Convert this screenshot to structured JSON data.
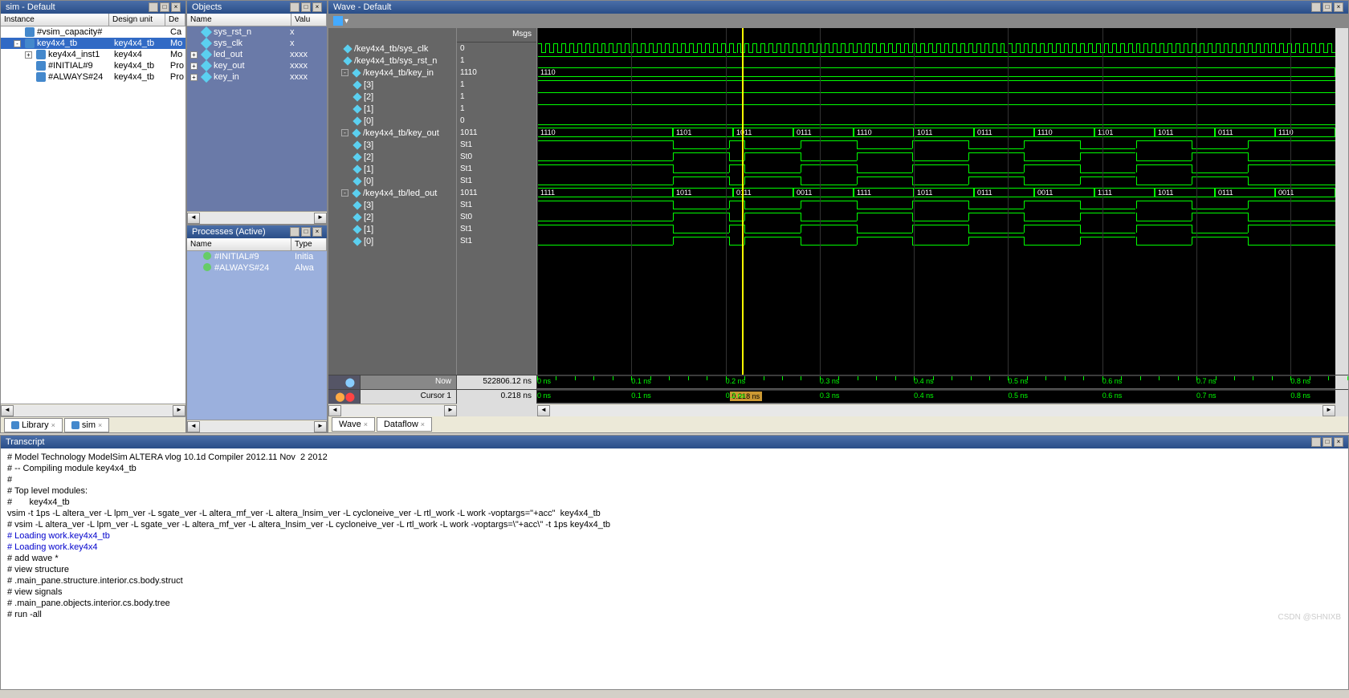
{
  "sim": {
    "title": "sim - Default",
    "columns": [
      "Instance",
      "Design unit",
      "De"
    ],
    "rows": [
      {
        "name": "#vsim_capacity#",
        "du": "",
        "ty": "Ca",
        "indent": 1,
        "exp": null
      },
      {
        "name": "key4x4_tb",
        "du": "key4x4_tb",
        "ty": "Mo",
        "indent": 1,
        "exp": "-",
        "sel": true
      },
      {
        "name": "key4x4_inst1",
        "du": "key4x4",
        "ty": "Mo",
        "indent": 2,
        "exp": "+"
      },
      {
        "name": "#INITIAL#9",
        "du": "key4x4_tb",
        "ty": "Pro",
        "indent": 2,
        "exp": null
      },
      {
        "name": "#ALWAYS#24",
        "du": "key4x4_tb",
        "ty": "Pro",
        "indent": 2,
        "exp": null
      }
    ],
    "tabs": [
      "Library",
      "sim"
    ]
  },
  "objects": {
    "title": "Objects",
    "columns": [
      "Name",
      "Valu"
    ],
    "rows": [
      {
        "name": "sys_rst_n",
        "val": "x",
        "exp": null
      },
      {
        "name": "sys_clk",
        "val": "x",
        "exp": null
      },
      {
        "name": "led_out",
        "val": "xxxx",
        "exp": "+"
      },
      {
        "name": "key_out",
        "val": "xxxx",
        "exp": "+"
      },
      {
        "name": "key_in",
        "val": "xxxx",
        "exp": "+"
      }
    ]
  },
  "processes": {
    "title": "Processes (Active)",
    "columns": [
      "Name",
      "Type"
    ],
    "rows": [
      {
        "name": "#INITIAL#9",
        "type": "Initia"
      },
      {
        "name": "#ALWAYS#24",
        "type": "Alwa"
      }
    ]
  },
  "wave": {
    "title": "Wave - Default",
    "msgs_header": "Msgs",
    "signals": [
      {
        "name": "/key4x4_tb/sys_clk",
        "msg": "0",
        "indent": 1,
        "type": "clock"
      },
      {
        "name": "/key4x4_tb/sys_rst_n",
        "msg": "1",
        "indent": 1,
        "type": "high"
      },
      {
        "name": "/key4x4_tb/key_in",
        "msg": "1110",
        "indent": 1,
        "exp": "-",
        "type": "bus",
        "values": [
          "1110"
        ]
      },
      {
        "name": "[3]",
        "msg": "1",
        "indent": 2,
        "type": "high"
      },
      {
        "name": "[2]",
        "msg": "1",
        "indent": 2,
        "type": "high"
      },
      {
        "name": "[1]",
        "msg": "1",
        "indent": 2,
        "type": "high"
      },
      {
        "name": "[0]",
        "msg": "0",
        "indent": 2,
        "type": "low"
      },
      {
        "name": "/key4x4_tb/key_out",
        "msg": "1011",
        "indent": 1,
        "exp": "-",
        "type": "bus",
        "values": [
          "1110",
          "1101",
          "1011",
          "0111",
          "1110",
          "1011",
          "0111",
          "1110",
          "1101",
          "1011",
          "0111",
          "1110"
        ]
      },
      {
        "name": "[3]",
        "msg": "St1",
        "indent": 2,
        "type": "var1"
      },
      {
        "name": "[2]",
        "msg": "St0",
        "indent": 2,
        "type": "var2"
      },
      {
        "name": "[1]",
        "msg": "St1",
        "indent": 2,
        "type": "var3"
      },
      {
        "name": "[0]",
        "msg": "St1",
        "indent": 2,
        "type": "var4"
      },
      {
        "name": "/key4x4_tb/led_out",
        "msg": "1011",
        "indent": 1,
        "exp": "-",
        "type": "bus",
        "values": [
          "1111",
          "1011",
          "0111",
          "0011",
          "1111",
          "1011",
          "0111",
          "0011",
          "1111",
          "1011",
          "0111",
          "0011"
        ]
      },
      {
        "name": "[3]",
        "msg": "St1",
        "indent": 2,
        "type": "var1"
      },
      {
        "name": "[2]",
        "msg": "St0",
        "indent": 2,
        "type": "var2"
      },
      {
        "name": "[1]",
        "msg": "St1",
        "indent": 2,
        "type": "var3"
      },
      {
        "name": "[0]",
        "msg": "St1",
        "indent": 2,
        "type": "var4"
      }
    ],
    "now_label": "Now",
    "now_value": "522806.12 ns",
    "cursor_label": "Cursor 1",
    "cursor_value": "0.218 ns",
    "cursor_badge": "0.218 ns",
    "time_ticks": [
      "0 ns",
      "0.1 ns",
      "0.2 ns",
      "0.3 ns",
      "0.4 ns",
      "0.5 ns",
      "0.6 ns",
      "0.7 ns",
      "0.8 ns"
    ],
    "tabs": [
      "Wave",
      "Dataflow"
    ]
  },
  "transcript": {
    "title": "Transcript",
    "lines": [
      {
        "t": "# Model Technology ModelSim ALTERA vlog 10.1d Compiler 2012.11 Nov  2 2012"
      },
      {
        "t": "# -- Compiling module key4x4_tb"
      },
      {
        "t": "# "
      },
      {
        "t": "# Top level modules:"
      },
      {
        "t": "#       key4x4_tb"
      },
      {
        "t": ""
      },
      {
        "t": "vsim -t 1ps -L altera_ver -L lpm_ver -L sgate_ver -L altera_mf_ver -L altera_lnsim_ver -L cycloneive_ver -L rtl_work -L work -voptargs=\"+acc\"  key4x4_tb"
      },
      {
        "t": "# vsim -L altera_ver -L lpm_ver -L sgate_ver -L altera_mf_ver -L altera_lnsim_ver -L cycloneive_ver -L rtl_work -L work -voptargs=\\\"+acc\\\" -t 1ps key4x4_tb "
      },
      {
        "t": "# Loading work.key4x4_tb",
        "blue": true
      },
      {
        "t": "# Loading work.key4x4",
        "blue": true
      },
      {
        "t": ""
      },
      {
        "t": "# add wave *"
      },
      {
        "t": "# view structure"
      },
      {
        "t": "# .main_pane.structure.interior.cs.body.struct"
      },
      {
        "t": "# view signals"
      },
      {
        "t": "# .main_pane.objects.interior.cs.body.tree"
      },
      {
        "t": "# run -all"
      }
    ]
  },
  "watermark": "CSDN @SHNIXB"
}
